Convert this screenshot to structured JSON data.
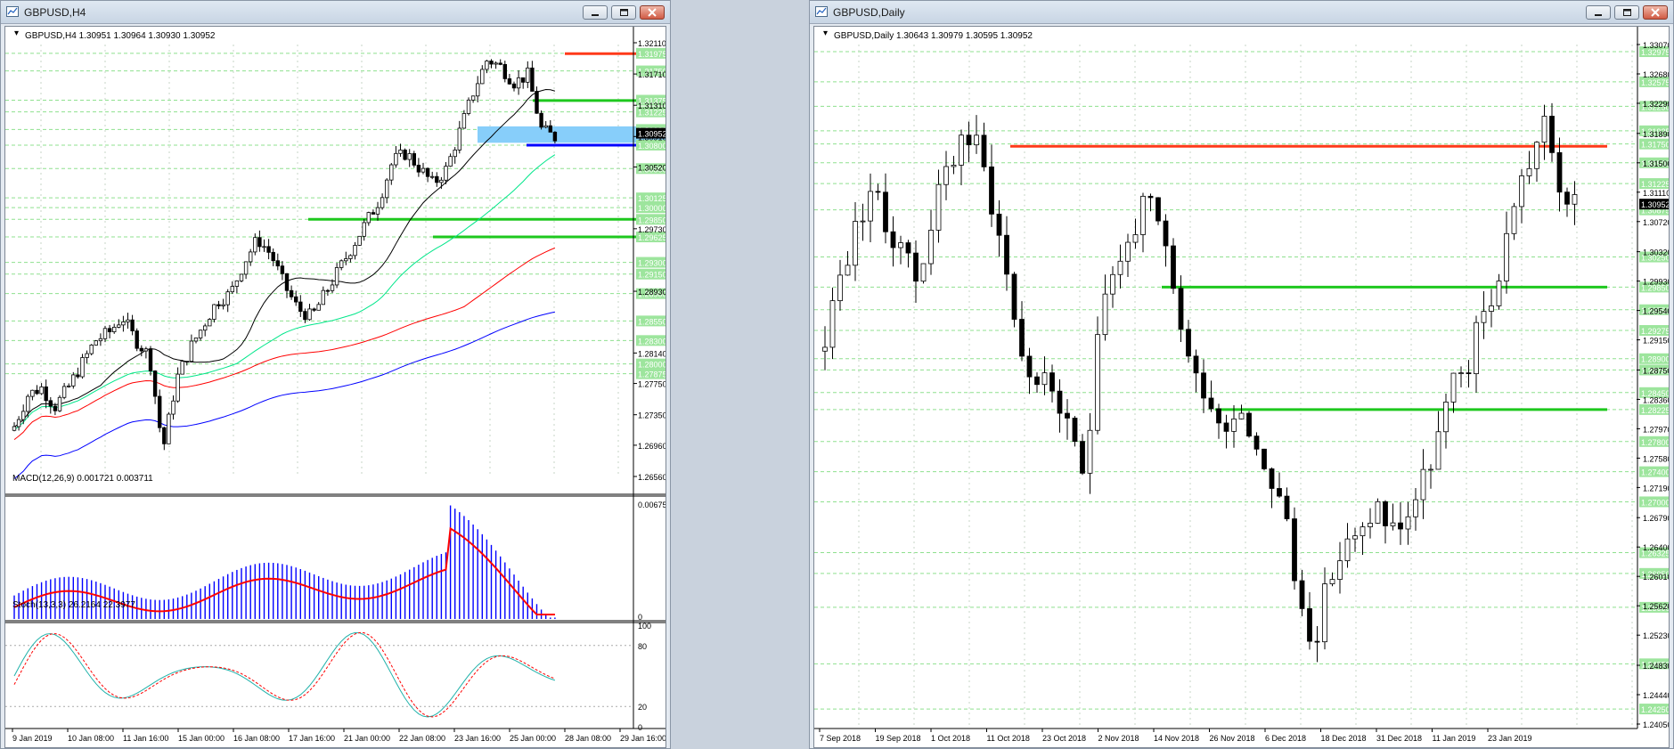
{
  "left": {
    "title": "GBPUSD,H4",
    "info": "GBPUSD,H4  1.30951 1.30964 1.30930 1.30952",
    "macd": {
      "label": "MACD(12,26,9) 0.001721 0.003711",
      "top": "0.006752",
      "zero": "0"
    },
    "stoch": {
      "label": "Stoch(13,3,3) 26.2164 22.3977",
      "levels": [
        "100",
        "80",
        "20",
        "0"
      ]
    },
    "price_labels": [
      "1.32110",
      "1.31710",
      "1.31310",
      "1.30910",
      "1.30520",
      "1.29730",
      "1.28930",
      "1.28140",
      "1.27750",
      "1.27350",
      "1.26960",
      "1.26560"
    ],
    "green_labels": [
      "1.31975",
      "1.31750",
      "1.31375",
      "1.31225",
      "1.31000",
      "1.30800",
      "1.30500",
      "1.30125",
      "1.30000",
      "1.29850",
      "1.29625",
      "1.29300",
      "1.29150",
      "1.28900",
      "1.28550",
      "1.28300",
      "1.28000",
      "1.27875"
    ],
    "current": "1.30952",
    "time_labels": [
      "9 Jan 2019",
      "10 Jan 08:00",
      "11 Jan 16:00",
      "15 Jan 00:00",
      "16 Jan 08:00",
      "17 Jan 16:00",
      "21 Jan 00:00",
      "22 Jan 08:00",
      "23 Jan 16:00",
      "25 Jan 00:00",
      "28 Jan 08:00",
      "29 Jan 16:00"
    ]
  },
  "right": {
    "title": "GBPUSD,Daily",
    "info": "GBPUSD,Daily  1.30643 1.30979 1.30595 1.30952",
    "price_labels": [
      "1.33070",
      "1.32680",
      "1.32290",
      "1.31890",
      "1.31500",
      "1.31110",
      "1.30720",
      "1.30320",
      "1.29930",
      "1.29540",
      "1.29150",
      "1.28750",
      "1.28360",
      "1.27970",
      "1.27580",
      "1.27190",
      "1.26790",
      "1.26400",
      "1.26010",
      "1.25620",
      "1.25230",
      "1.24830",
      "1.24440",
      "1.24050"
    ],
    "green_labels": [
      "1.32975",
      "1.32575",
      "1.32250",
      "1.31925",
      "1.31750",
      "1.31500",
      "1.31225",
      "1.30875",
      "1.30250",
      "1.29850",
      "1.29550",
      "1.29275",
      "1.28900",
      "1.28750",
      "1.28450",
      "1.28225",
      "1.27800",
      "1.27400",
      "1.27000",
      "1.26325",
      "1.26050",
      "1.25600",
      "1.24850",
      "1.24250"
    ],
    "current": "1.30952",
    "time_labels": [
      "7 Sep 2018",
      "19 Sep 2018",
      "1 Oct 2018",
      "11 Oct 2018",
      "23 Oct 2018",
      "2 Nov 2018",
      "14 Nov 2018",
      "26 Nov 2018",
      "6 Dec 2018",
      "18 Dec 2018",
      "31 Dec 2018",
      "11 Jan 2019",
      "23 Jan 2019"
    ]
  },
  "colors": {
    "red_level": "#ff3a1a",
    "green_level": "#1ec81e",
    "blue_level": "#0000ff",
    "zone": "#87cefa",
    "macd_bar": "#0000ff",
    "macd_signal": "#ff0000",
    "stoch_main": "#20b2aa",
    "stoch_signal": "#ff0000",
    "grid_green": "#8fe08f"
  }
}
